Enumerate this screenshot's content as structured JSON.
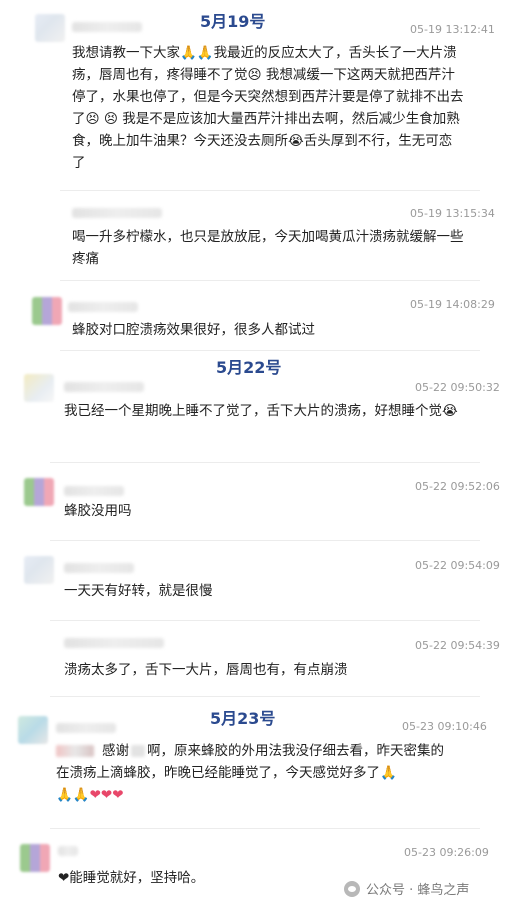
{
  "dates": [
    "5月19号",
    "5月22号",
    "5月23号"
  ],
  "comments": [
    {
      "timestamp": "05-19 13:12:41",
      "text": "我想请教一下大家🙏🙏我最近的反应太大了，舌头长了一大片溃疡，唇周也有，疼得睡不了觉😣 我想减缓一下这两天就把西芹汁停了，水果也停了，但是今天突然想到西芹汁要是停了就排不出去了😣 😣 我是不是应该加大量西芹汁排出去啊，然后减少生食加熟食，晚上加牛油果？今天还没去厕所😭舌头厚到不行，生无可恋了"
    },
    {
      "timestamp": "05-19 13:15:34",
      "text": "喝一升多柠檬水，也只是放放屁，今天加喝黄瓜汁溃疡就缓解一些疼痛"
    },
    {
      "timestamp": "05-19 14:08:29",
      "text": "蜂胶对口腔溃疡效果很好，很多人都试过"
    },
    {
      "timestamp": "05-22 09:50:32",
      "text": "我已经一个星期晚上睡不了觉了，舌下大片的溃疡，好想睡个觉😭"
    },
    {
      "timestamp": "05-22 09:52:06",
      "text": "蜂胶没用吗"
    },
    {
      "timestamp": "05-22 09:54:09",
      "text": "一天天有好转，就是很慢"
    },
    {
      "timestamp": "05-22 09:54:39",
      "text": "溃疡太多了，舌下一大片，唇周也有，有点崩溃"
    },
    {
      "timestamp": "05-23 09:10:46",
      "text_a": "感谢",
      "text_b": "啊，原来蜂胶的外用法我没仔细去看，昨天密集的在溃疡上滴蜂胶，昨晚已经能睡觉了，今天感觉好多了🙏",
      "text_c": "🙏🙏❤❤❤"
    },
    {
      "timestamp": "05-23 09:26:09",
      "text": "❤能睡觉就好，坚持哈。"
    }
  ],
  "watermark": "公众号 · 蜂鸟之声"
}
